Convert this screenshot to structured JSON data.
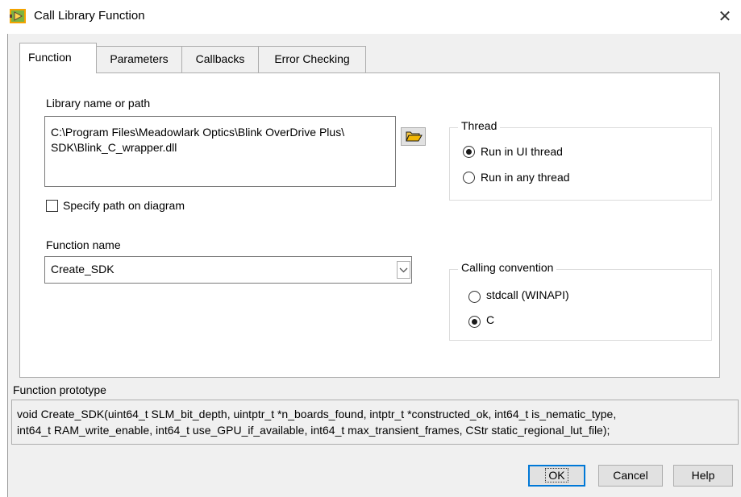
{
  "window": {
    "title": "Call Library Function",
    "icon": "call-library-function-icon",
    "close_glyph": "✕"
  },
  "tabs": [
    {
      "label": "Function",
      "active": true
    },
    {
      "label": "Parameters",
      "active": false
    },
    {
      "label": "Callbacks",
      "active": false
    },
    {
      "label": "Error Checking",
      "active": false
    }
  ],
  "library": {
    "label": "Library name or path",
    "path_line1": "C:\\Program Files\\Meadowlark Optics\\Blink OverDrive Plus\\",
    "path_line2": "SDK\\Blink_C_wrapper.dll",
    "browse_icon": "folder-open-icon"
  },
  "specify_path": {
    "label": "Specify path on diagram",
    "checked": false
  },
  "function_name": {
    "label": "Function name",
    "value": "Create_SDK"
  },
  "thread": {
    "label": "Thread",
    "options": [
      {
        "label": "Run in UI thread",
        "selected": true
      },
      {
        "label": "Run in any thread",
        "selected": false
      }
    ]
  },
  "calling_convention": {
    "label": "Calling convention",
    "options": [
      {
        "label": "stdcall (WINAPI)",
        "selected": false
      },
      {
        "label": "C",
        "selected": true
      }
    ]
  },
  "prototype": {
    "label": "Function prototype",
    "line1": "void  Create_SDK(uint64_t SLM_bit_depth, uintptr_t *n_boards_found, intptr_t *constructed_ok, int64_t is_nematic_type,",
    "line2": "int64_t RAM_write_enable, int64_t use_GPU_if_available, int64_t max_transient_frames, CStr static_regional_lut_file);"
  },
  "buttons": {
    "ok": "OK",
    "cancel": "Cancel",
    "help": "Help"
  },
  "colors": {
    "focus_border": "#0078d7",
    "icon_green": "#7cb342",
    "icon_orange": "#f4a300"
  }
}
